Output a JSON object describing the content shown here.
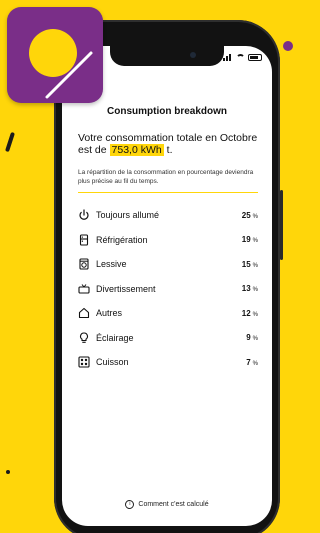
{
  "screen": {
    "title": "Consumption breakdown",
    "headline_prefix": "Votre consommation totale en Octobre est de",
    "headline_value": "753,0 kWh",
    "headline_suffix": "t.",
    "note": "La répartition de la consommation en pourcentage deviendra plus précise au fil du temps.",
    "footer_link": "Comment c'est calculé"
  },
  "categories": [
    {
      "label": "Toujours allumé",
      "value": "25",
      "unit": "%",
      "icon": "power-icon"
    },
    {
      "label": "Réfrigération",
      "value": "19",
      "unit": "%",
      "icon": "fridge-icon"
    },
    {
      "label": "Lessive",
      "value": "15",
      "unit": "%",
      "icon": "washing-machine-icon"
    },
    {
      "label": "Divertissement",
      "value": "13",
      "unit": "%",
      "icon": "tv-icon"
    },
    {
      "label": "Autres",
      "value": "12",
      "unit": "%",
      "icon": "house-icon"
    },
    {
      "label": "Éclairage",
      "value": "9",
      "unit": "%",
      "icon": "lightbulb-icon"
    },
    {
      "label": "Cuisson",
      "value": "7",
      "unit": "%",
      "icon": "stove-icon"
    }
  ],
  "colors": {
    "background": "#ffd60a",
    "highlight": "#ffd60a",
    "badge": "#7a2e88"
  }
}
